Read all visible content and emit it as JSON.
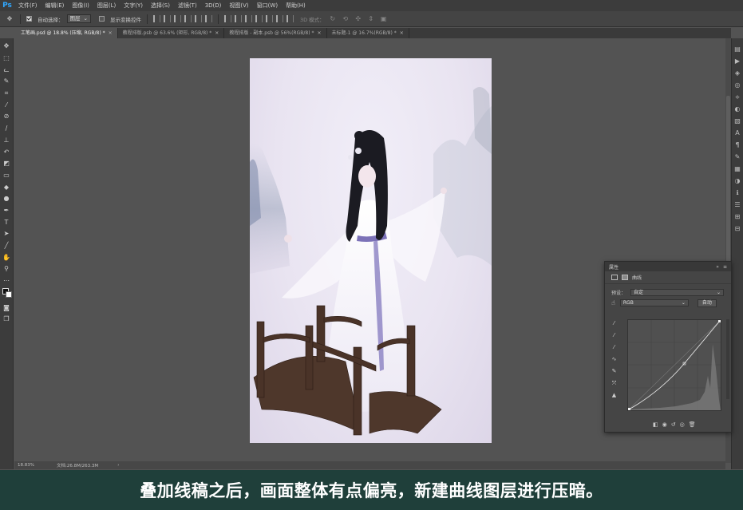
{
  "app": {
    "logo": "Ps"
  },
  "menu": [
    "文件(F)",
    "编辑(E)",
    "图像(I)",
    "图层(L)",
    "文字(Y)",
    "选择(S)",
    "滤镜(T)",
    "3D(D)",
    "视图(V)",
    "窗口(W)",
    "帮助(H)"
  ],
  "options": {
    "auto_select_label": "自动选择：",
    "auto_select_value": "图层",
    "transform_label": "显示变换控件",
    "mode_3d_label": "3D 模式："
  },
  "tabs": [
    {
      "label": "工笔画.psd @ 18.8% (压缩, RGB/8) *",
      "active": true
    },
    {
      "label": "教程排版.psb @ 63.6% (矩形, RGB/8) *",
      "active": false
    },
    {
      "label": "教程排版 - 副本.psb @ 56%(RGB/8) *",
      "active": false
    },
    {
      "label": "未标题-1 @ 16.7%(RGB/8) *",
      "active": false
    }
  ],
  "status": {
    "zoom": "18.83%",
    "doc": "文档:26.8M/263.3M",
    "arrow": "›"
  },
  "properties": {
    "title": "属性",
    "subtitle": "曲线",
    "preset_label": "预设：",
    "preset_value": "自定",
    "channel_value": "RGB",
    "auto_label": "自动"
  },
  "caption": "叠加线稿之后，画面整体有点偏亮，新建曲线图层进行压暗。",
  "colors": {
    "caption_bg": "#1f3f3a",
    "ps_blue": "#31a8ff"
  },
  "icons": [
    "move-icon",
    "marquee-icon",
    "lasso-icon",
    "quick-select-icon",
    "crop-icon",
    "eyedropper-icon",
    "healing-icon",
    "brush-icon",
    "stamp-icon",
    "history-brush-icon",
    "eraser-icon",
    "gradient-icon",
    "blur-icon",
    "dodge-icon",
    "pen-icon",
    "type-icon",
    "path-select-icon",
    "line-icon",
    "hand-icon",
    "zoom-icon",
    "more-icon"
  ]
}
